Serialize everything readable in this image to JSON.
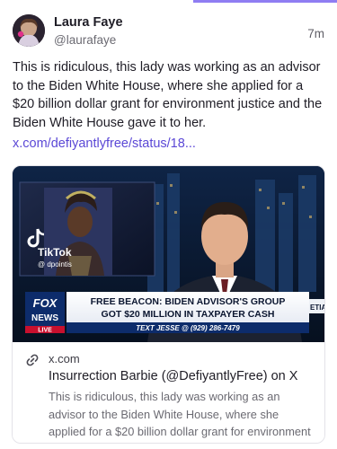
{
  "post": {
    "author_name": "Laura Faye",
    "author_handle": "@laurafaye",
    "time": "7m",
    "text": "This is ridiculous, this lady was working as an advisor to the Biden White House, where she applied for a $20 billion dollar grant for environment justice and the Biden White House gave it to her.",
    "link_text": "x.com/defiyantlyfree/status/18..."
  },
  "card": {
    "domain": "x.com",
    "title": "Insurrection Barbie (@DefiyantlyFree) on X",
    "description": "This is ridiculous, this lady was working as an advisor to the Biden  White House, where she applied for a $20 billion dollar grant for environment justice and the Biden White House gave it to her.",
    "video": {
      "watermark_brand": "TikTok",
      "watermark_handle": "@ dpointis",
      "channel_logo_top": "FOX",
      "channel_logo_bottom": "NEWS",
      "channel_logo_live": "LIVE",
      "headline_line1": "FREE BEACON: BIDEN ADVISOR'S GROUP",
      "headline_line2": "GOT $20 MILLION IN TAXPAYER CASH",
      "ticker": "TEXT JESSE @ (929) 286-7479",
      "side_text": "ETIA"
    }
  },
  "colors": {
    "accent": "#8f7df2",
    "link": "#5b48d6",
    "fox_red": "#c8102e",
    "fox_blue": "#0d2c6b"
  },
  "icons": {
    "link": "link-chain-icon"
  }
}
